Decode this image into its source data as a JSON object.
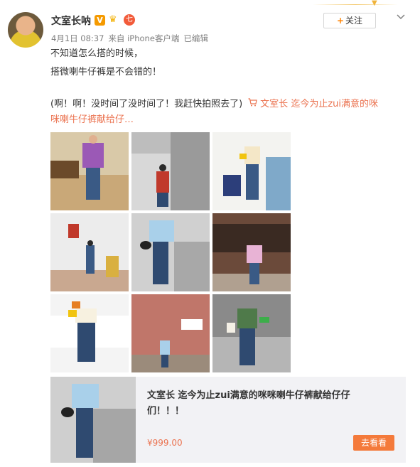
{
  "post": {
    "author": "文室长呐",
    "badges": {
      "verified": "V",
      "crown": "♛",
      "level": "七"
    },
    "meta": {
      "date": "4月1日 08:37",
      "source": "来自 iPhone客户端",
      "status": "已编辑"
    },
    "follow_label": "关注",
    "follow_plus": "+",
    "text_line1": "不知道怎么搭的时候，",
    "text_line2": "搭微喇牛仔裤是不会错的！",
    "text_line3": "(啊！啊！没时间了没时间了！我赶快拍照去了)",
    "link_prefix": "文室长",
    "link_line3": "迄今为止zui满意的咪",
    "link_line4": "咪喇牛仔裤献给仔…"
  },
  "product_card": {
    "title": "文室长 迄今为止zui满意的咪咪喇牛仔裤献给仔仔们！！！",
    "price": "¥999.00",
    "button": "去看看"
  },
  "colors": {
    "accent": "#eb7350",
    "orange": "#ff8200",
    "button": "#f47a3b",
    "muted": "#808080",
    "card_bg": "#f2f2f5"
  },
  "icons": [
    "avatar",
    "verified-icon",
    "crown-icon",
    "level-badge-icon",
    "chevron-down-icon",
    "cart-icon"
  ]
}
